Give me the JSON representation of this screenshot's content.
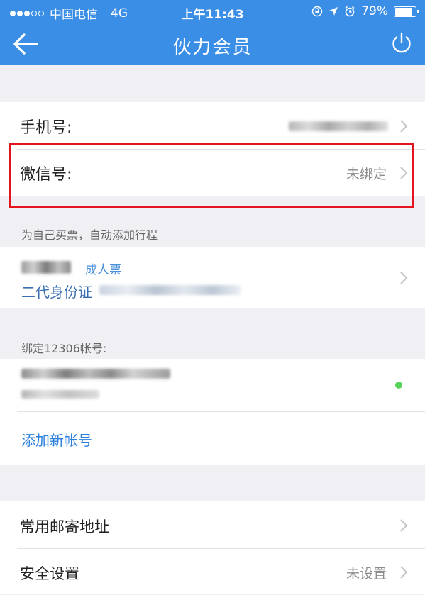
{
  "status_bar": {
    "carrier": "中国电信",
    "network": "4G",
    "time": "上午11:43",
    "battery": "79%",
    "battery_level": 0.79
  },
  "nav": {
    "title": "伙力会员",
    "back_icon": "back-arrow-icon",
    "power_icon": "power-icon"
  },
  "account": {
    "phone_label": "手机号:",
    "wechat_label": "微信号:",
    "wechat_value": "未绑定"
  },
  "passenger": {
    "section_title": "为自己买票，自动添加行程",
    "ticket_type": "成人票",
    "id_type": "二代身份证"
  },
  "accounts_12306": {
    "section_title": "绑定12306帐号:",
    "add_label": "添加新帐号",
    "status_color": "#5ad35a"
  },
  "settings": {
    "address_label": "常用邮寄地址",
    "security_label": "安全设置",
    "security_value": "未设置"
  },
  "colors": {
    "accent": "#3a8ee6",
    "link": "#2b7fdc",
    "highlight": "#e3141e"
  }
}
